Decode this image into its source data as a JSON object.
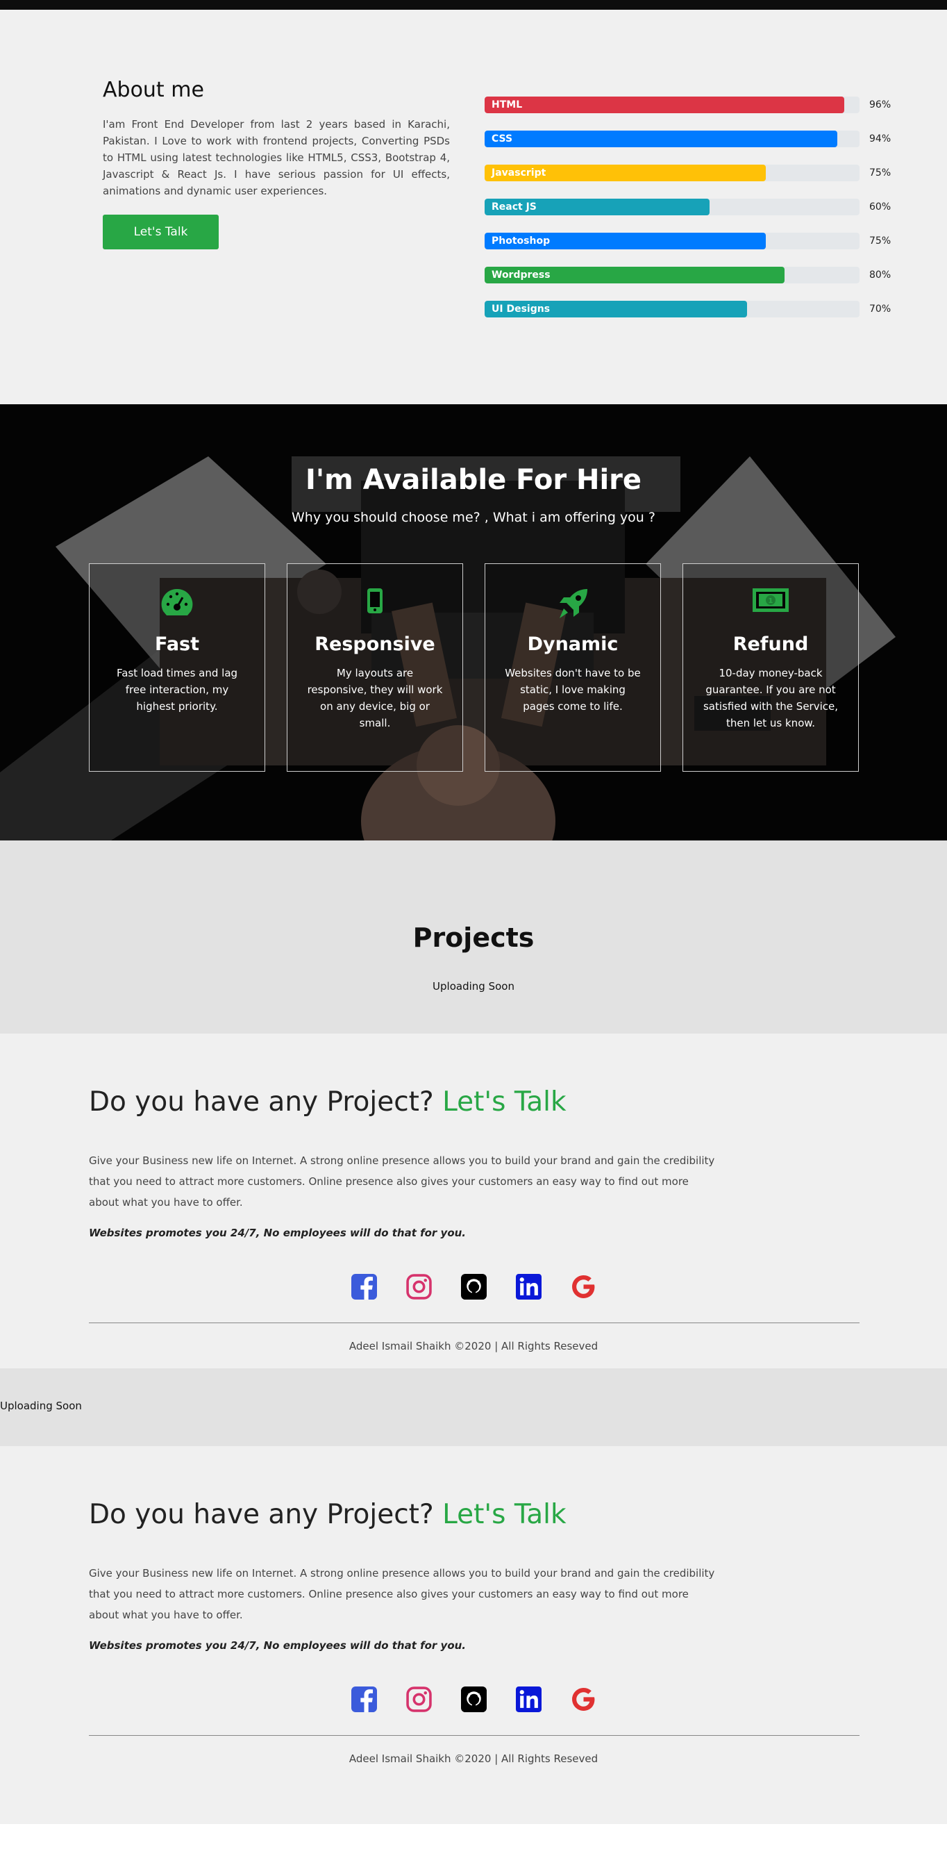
{
  "about": {
    "title": "About me",
    "text": "I'am Front End Developer from last 2 years based in Karachi, Pakistan. I Love to work with frontend projects, Converting PSDs to HTML using latest technologies like HTML5, CSS3, Bootstrap 4, Javascript & React Js. I have serious passion for UI effects, animations and dynamic user experiences.",
    "button_label": "Let's Talk",
    "button_color": "#28a745"
  },
  "skills": [
    {
      "label": "HTML",
      "value": 96,
      "display": "96%",
      "color": "#dc3545"
    },
    {
      "label": "CSS",
      "value": 94,
      "display": "94%",
      "color": "#007bff"
    },
    {
      "label": "Javascript",
      "value": 75,
      "display": "75%",
      "color": "#ffc107"
    },
    {
      "label": "React JS",
      "value": 60,
      "display": "60%",
      "color": "#17a2b8"
    },
    {
      "label": "Photoshop",
      "value": 75,
      "display": "75%",
      "color": "#007bff"
    },
    {
      "label": "Wordpress",
      "value": 80,
      "display": "80%",
      "color": "#28a745"
    },
    {
      "label": "UI Designs",
      "value": 70,
      "display": "70%",
      "color": "#17a2b8"
    }
  ],
  "hire": {
    "title": "I'm Available For Hire",
    "subtitle": "Why you should choose me? , What i am offering you ?",
    "icon_color": "#28a745",
    "cards": [
      {
        "icon": "speedometer-icon",
        "title": "Fast",
        "text": "Fast load times and lag free interaction, my highest priority."
      },
      {
        "icon": "mobile-phone-icon",
        "title": "Responsive",
        "text": "My layouts are responsive, they will work on any device, big or small."
      },
      {
        "icon": "rocket-icon",
        "title": "Dynamic",
        "text": "Websites don't have to be static, I love making pages come to life."
      },
      {
        "icon": "money-bill-icon",
        "title": "Refund",
        "text": "10-day money-back guarantee. If you are not satisfied with the Service, then let us know."
      }
    ]
  },
  "projects": {
    "title": "Projects",
    "status": "Uploading Soon"
  },
  "contact": {
    "heading": "Do you have any Project?",
    "heading_accent": "Let's Talk",
    "text": "Give your Business new life on Internet. A strong online presence allows you to build your brand and gain the credibility that you need to attract more customers. Online presence also gives your customers an easy way to find out more about what you have to offer.",
    "note": "Websites promotes you 24/7, No employees will do that for you.",
    "social": [
      {
        "icon": "facebook-icon",
        "color": "#3b5bdb"
      },
      {
        "icon": "instagram-icon",
        "color": "#d6336c"
      },
      {
        "icon": "github-icon",
        "color": "#000000"
      },
      {
        "icon": "linkedin-icon",
        "color": "#0a18d8"
      },
      {
        "icon": "google-icon",
        "color": "#e03131"
      }
    ],
    "footer": "Adeel Ismail Shaikh ©2020 | All Rights Reseved"
  },
  "upload_band": {
    "status": "Uploading Soon"
  }
}
